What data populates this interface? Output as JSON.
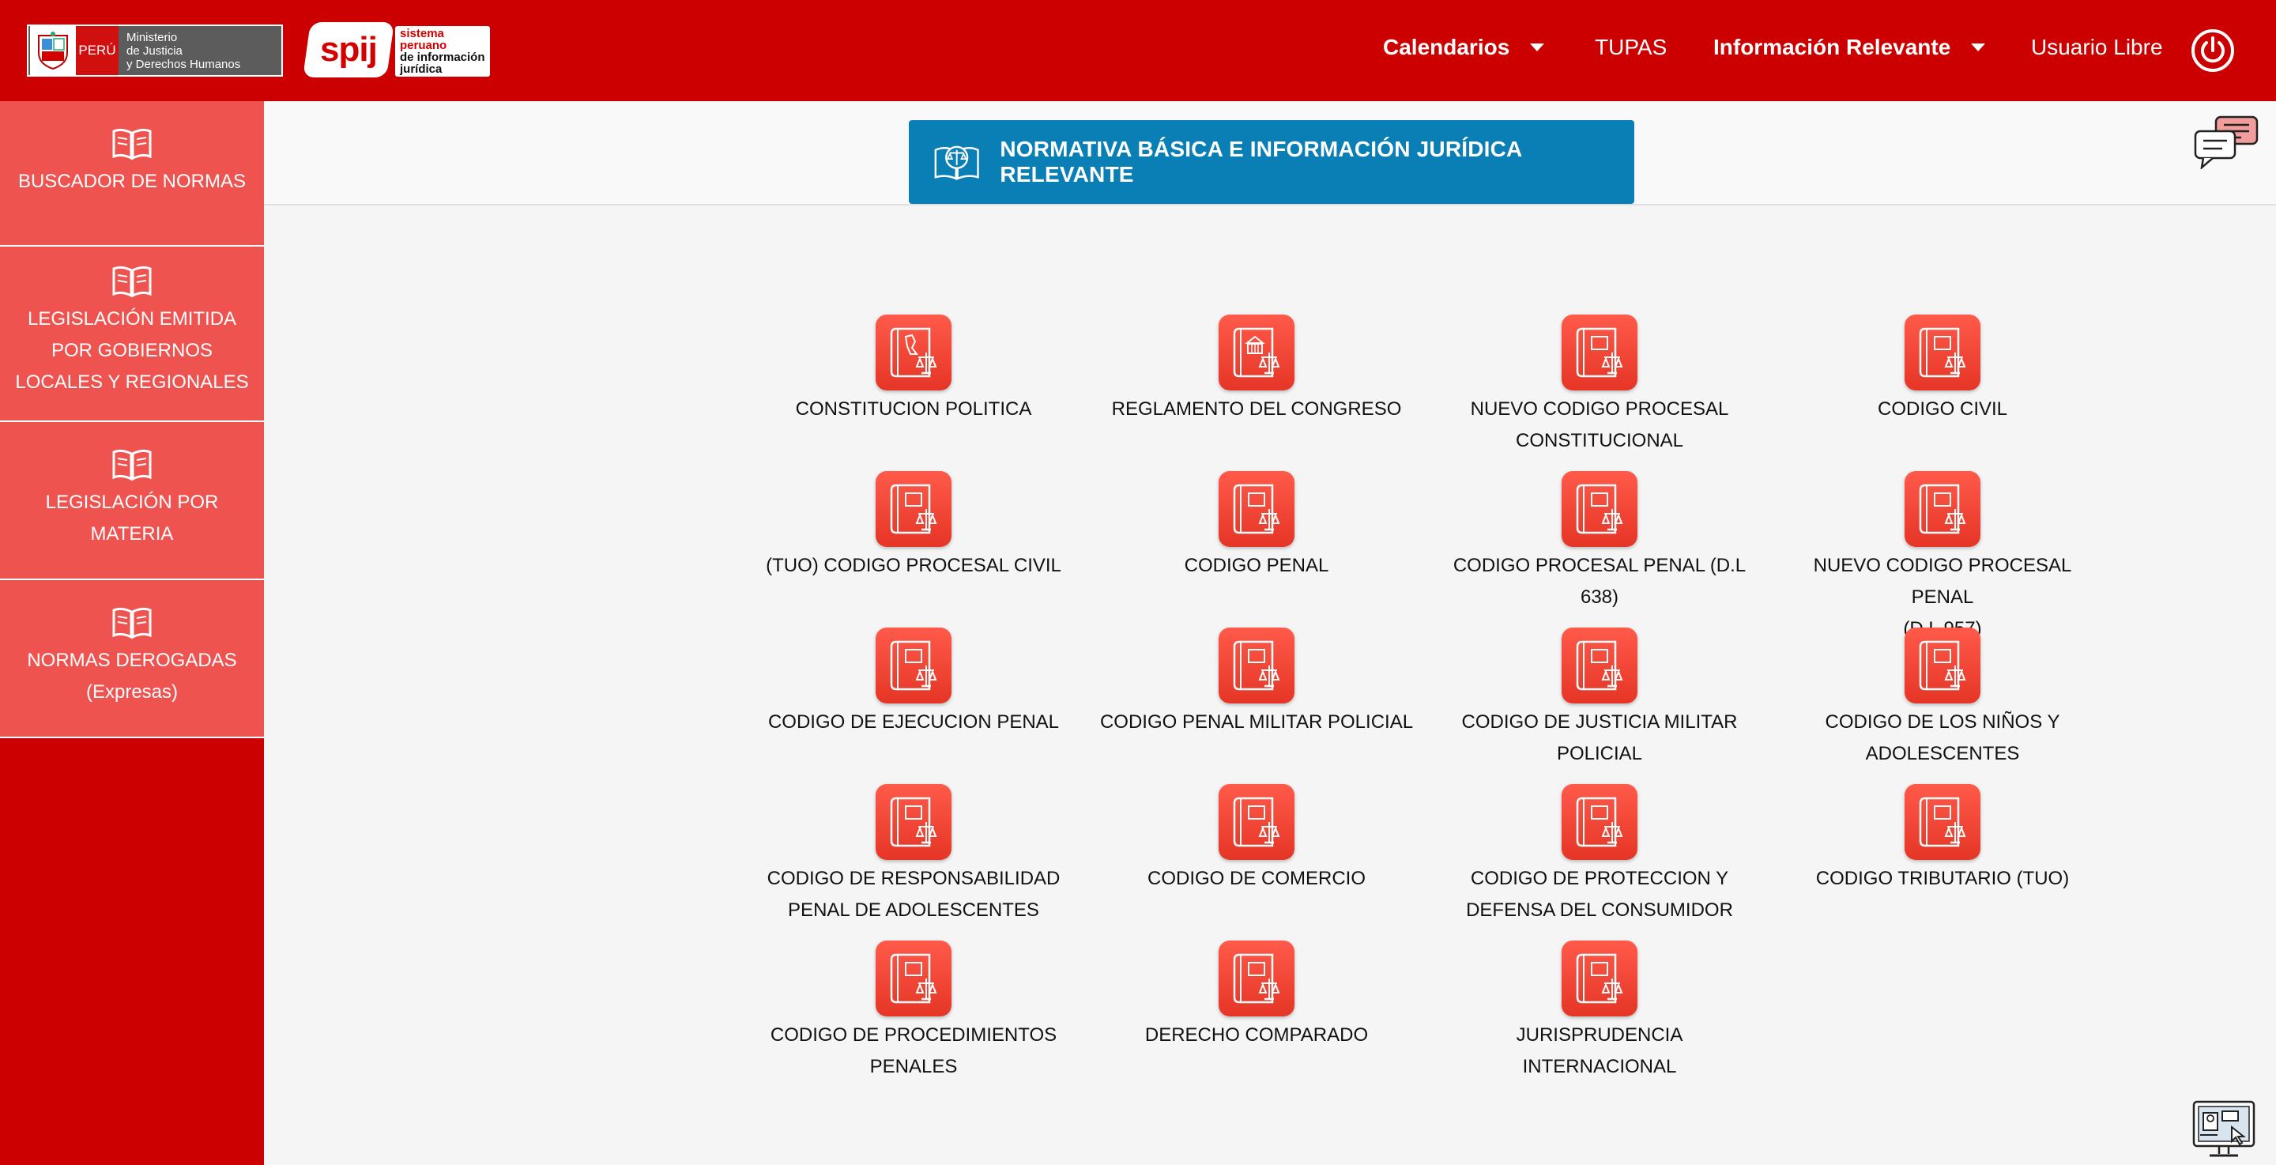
{
  "header": {
    "gov_logo": {
      "country": "PERÚ",
      "ministry_lines": [
        "Ministerio",
        "de Justicia",
        "y Derechos Humanos"
      ]
    },
    "spij_logo": {
      "mark": "spij",
      "lines": [
        "sistema",
        "peruano",
        "de información",
        "jurídica"
      ]
    },
    "nav": {
      "calendarios": "Calendarios",
      "tupas": "TUPAS",
      "informacion": "Información Relevante",
      "usuario": "Usuario Libre"
    }
  },
  "sidebar": {
    "items": [
      {
        "lines": [
          "BUSCADOR DE NORMAS"
        ]
      },
      {
        "lines": [
          "LEGISLACIÓN EMITIDA",
          "POR GOBIERNOS",
          "LOCALES Y REGIONALES"
        ]
      },
      {
        "lines": [
          "LEGISLACIÓN POR",
          "MATERIA"
        ]
      },
      {
        "lines": [
          "NORMAS DEROGADAS",
          "(Expresas)"
        ]
      }
    ]
  },
  "main": {
    "banner_title": "NORMATIVA BÁSICA E INFORMACIÓN JURÍDICA RELEVANTE",
    "items": [
      {
        "lines": [
          "CONSTITUCION POLITICA"
        ],
        "icon": "constitution-book-icon"
      },
      {
        "lines": [
          "REGLAMENTO DEL CONGRESO"
        ],
        "icon": "congress-book-icon"
      },
      {
        "lines": [
          "NUEVO CODIGO PROCESAL",
          "CONSTITUCIONAL"
        ],
        "icon": "law-book-icon"
      },
      {
        "lines": [
          "CODIGO CIVIL"
        ],
        "icon": "law-book-icon"
      },
      {
        "lines": [
          "(TUO) CODIGO PROCESAL CIVIL"
        ],
        "icon": "law-book-icon"
      },
      {
        "lines": [
          "CODIGO PENAL"
        ],
        "icon": "law-book-icon"
      },
      {
        "lines": [
          "CODIGO PROCESAL PENAL (D.L",
          "638)"
        ],
        "icon": "law-book-icon"
      },
      {
        "lines": [
          "NUEVO CODIGO PROCESAL PENAL",
          "(D.L 957)"
        ],
        "icon": "law-book-icon"
      },
      {
        "lines": [
          "CODIGO DE EJECUCION PENAL"
        ],
        "icon": "law-book-icon"
      },
      {
        "lines": [
          "CODIGO PENAL MILITAR POLICIAL"
        ],
        "icon": "law-book-icon"
      },
      {
        "lines": [
          "CODIGO DE JUSTICIA MILITAR",
          "POLICIAL"
        ],
        "icon": "law-book-icon"
      },
      {
        "lines": [
          "CODIGO DE LOS NIÑOS Y",
          "ADOLESCENTES"
        ],
        "icon": "law-book-icon"
      },
      {
        "lines": [
          "CODIGO DE RESPONSABILIDAD",
          "PENAL DE ADOLESCENTES"
        ],
        "icon": "law-book-icon"
      },
      {
        "lines": [
          "CODIGO DE COMERCIO"
        ],
        "icon": "law-book-icon"
      },
      {
        "lines": [
          "CODIGO DE PROTECCION Y",
          "DEFENSA DEL CONSUMIDOR"
        ],
        "icon": "law-book-icon"
      },
      {
        "lines": [
          "CODIGO TRIBUTARIO (TUO)"
        ],
        "icon": "law-book-icon"
      },
      {
        "lines": [
          "CODIGO DE PROCEDIMIENTOS",
          "PENALES"
        ],
        "icon": "law-book-icon"
      },
      {
        "lines": [
          "DERECHO COMPARADO"
        ],
        "icon": "law-book-icon"
      },
      {
        "lines": [
          "JURISPRUDENCIA INTERNACIONAL"
        ],
        "icon": "law-book-icon"
      }
    ]
  },
  "colors": {
    "topbar": "#cc0000",
    "sidebar_item": "#ef5350",
    "banner": "#0a7fb6",
    "tile": "#f0402f"
  }
}
